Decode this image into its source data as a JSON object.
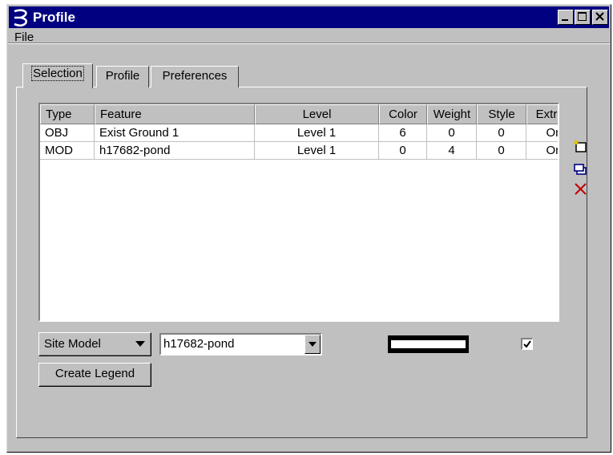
{
  "window": {
    "title": "Profile"
  },
  "menu": {
    "file_label": "File"
  },
  "tabs": [
    {
      "label": "Selection",
      "active": true
    },
    {
      "label": "Profile",
      "active": false
    },
    {
      "label": "Preferences",
      "active": false
    }
  ],
  "table": {
    "columns": [
      "Type",
      "Feature",
      "Level",
      "Color",
      "Weight",
      "Style",
      "Extract"
    ],
    "rows": [
      {
        "type": "OBJ",
        "feature": "Exist Ground 1",
        "level": "Level 1",
        "color": "6",
        "weight": "0",
        "style": "0",
        "extract": "On"
      },
      {
        "type": "MOD",
        "feature": "h17682-pond",
        "level": "Level 1",
        "color": "0",
        "weight": "4",
        "style": "0",
        "extract": "On"
      }
    ]
  },
  "side_toolbar": {
    "icons": [
      "new-entry-icon",
      "copy-icon",
      "delete-icon"
    ],
    "delete_color": "#c00000"
  },
  "controls": {
    "type_dropdown": "Site Model",
    "feature_combo": "h17682-pond",
    "create_legend_label": "Create Legend",
    "extract_checked": true
  },
  "colors": {
    "titlebar": "#000080",
    "face": "#c0c0c0"
  }
}
